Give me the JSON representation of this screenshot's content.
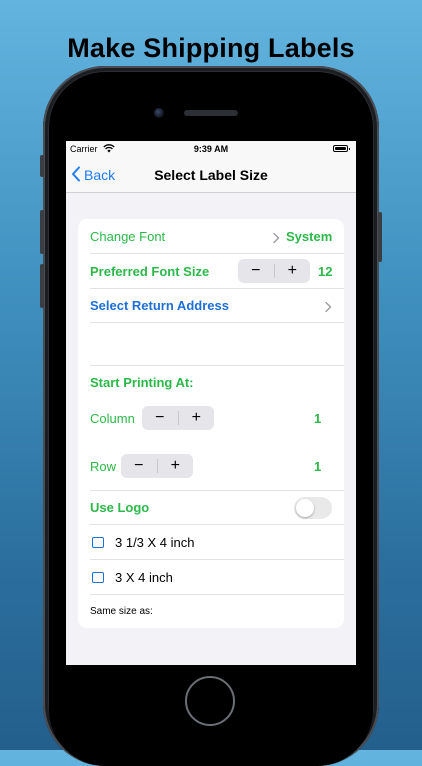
{
  "headline": "Make Shipping Labels",
  "status_bar": {
    "carrier": "Carrier",
    "time": "9:39 AM"
  },
  "nav": {
    "back_label": "Back",
    "title": "Select Label Size"
  },
  "settings": {
    "change_font": {
      "label": "Change Font",
      "value": "System"
    },
    "preferred_font_size": {
      "label": "Preferred Font Size",
      "value": "12",
      "decrement": "−",
      "increment": "+"
    },
    "select_return_address": {
      "label": "Select Return Address"
    },
    "start_printing_at": {
      "label": "Start Printing At:"
    },
    "column": {
      "label": "Column",
      "value": "1",
      "decrement": "−",
      "increment": "+"
    },
    "row": {
      "label": "Row",
      "value": "1",
      "decrement": "−",
      "increment": "+"
    },
    "use_logo": {
      "label": "Use Logo",
      "enabled": false
    },
    "label_sizes": [
      {
        "label": "3 1/3 X 4 inch",
        "checked": false
      },
      {
        "label": "3 X 4 inch",
        "checked": false
      }
    ],
    "same_size_as": {
      "label": "Same size as:"
    }
  },
  "colors": {
    "green": "#2db84a",
    "blue": "#1e6fd6",
    "ios_blue": "#1e7cf0"
  },
  "icons": [
    "chevron-left-icon",
    "chevron-right-icon",
    "wifi-icon",
    "battery-icon",
    "checkbox-icon"
  ]
}
